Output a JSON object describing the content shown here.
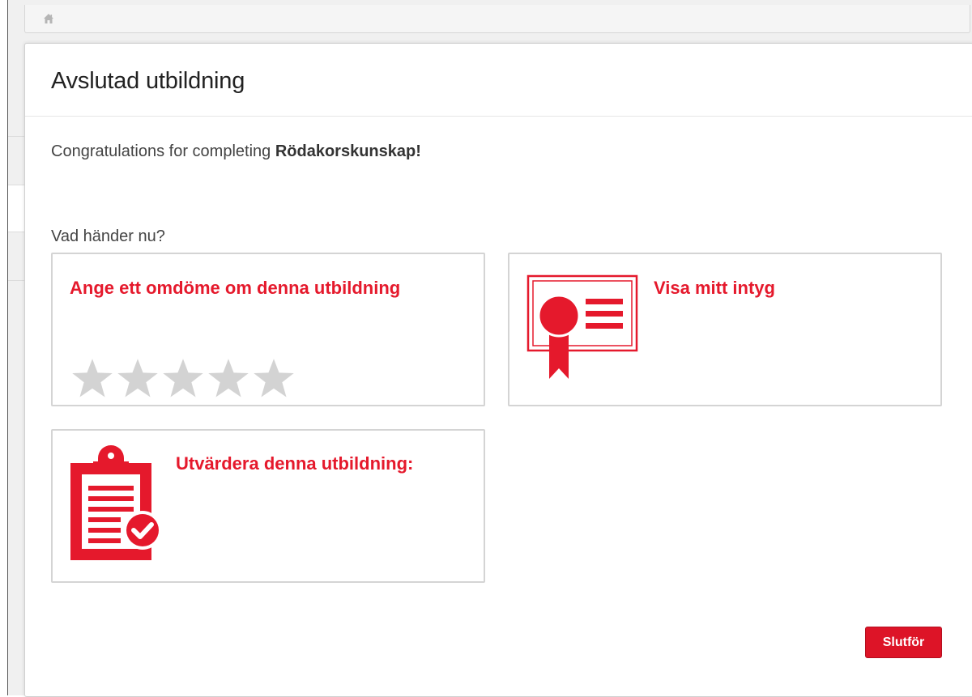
{
  "breadcrumb": {
    "icon": "home-icon"
  },
  "modal": {
    "title": "Avslutad utbildning",
    "congrats_prefix": "Congratulations for completing ",
    "course_name": "Rödakorskunskap!",
    "next_label": "Vad händer nu?"
  },
  "cards": {
    "rate": {
      "title": "Ange ett omdöme om denna utbildning",
      "rating": 0,
      "max_rating": 5
    },
    "certificate": {
      "title": "Visa mitt intyg",
      "icon": "certificate-icon"
    },
    "evaluate": {
      "title": "Utvärdera denna utbildning:",
      "icon": "clipboard-check-icon"
    }
  },
  "actions": {
    "finish_label": "Slutför"
  },
  "colors": {
    "accent": "#e5192c",
    "button": "#dd1427",
    "star_empty": "#d3d3d3"
  }
}
